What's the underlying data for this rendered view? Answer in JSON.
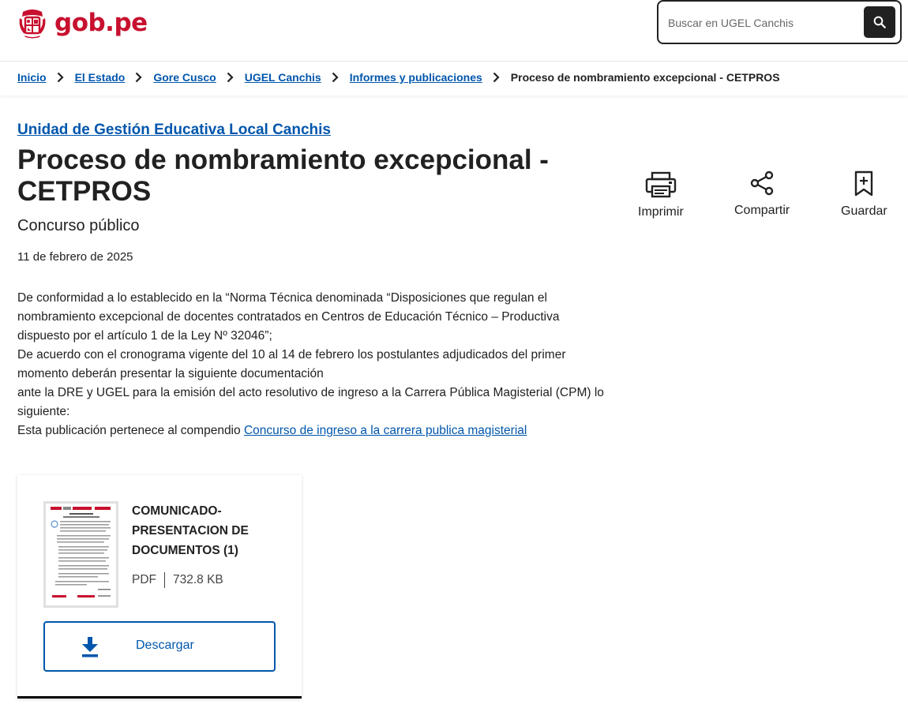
{
  "header": {
    "logo_text": "gob.pe",
    "search_placeholder": "Buscar en UGEL Canchis"
  },
  "breadcrumb": {
    "items": [
      "Inicio",
      "El Estado",
      "Gore Cusco",
      "UGEL Canchis",
      "Informes y publicaciones"
    ],
    "current": "Proceso de nombramiento excepcional - CETPROS"
  },
  "main": {
    "org_link": "Unidad de Gestión Educativa Local Canchis",
    "title": "Proceso de nombramiento excepcional - CETPROS",
    "subtitle": "Concurso público",
    "date": "11 de febrero de 2025",
    "paragraphs": [
      "De conformidad a lo establecido en la “Norma Técnica denominada “Disposiciones que regulan el nombramiento excepcional de docentes contratados en Centros de Educación Técnico – Productiva dispuesto por el artículo 1 de la Ley Nº 32046”;",
      "De acuerdo con el cronograma vigente del 10 al 14 de febrero los postulantes adjudicados del primer momento deberán presentar la siguiente documentación",
      "ante la DRE y UGEL para la emisión del acto resolutivo de ingreso a la Carrera Pública Magisterial (CPM) lo siguiente:"
    ],
    "compendium_prefix": "Esta publicación pertenece al compendio ",
    "compendium_link": "Concurso de ingreso a la carrera publica magisterial"
  },
  "actions": {
    "print_label": "Imprimir",
    "share_label": "Compartir",
    "save_label": "Guardar"
  },
  "document": {
    "title": "COMUNICADO-PRESENTACION DE DOCUMENTOS (1)",
    "format": "PDF",
    "size": "732.8 KB",
    "download_label": "Descargar"
  },
  "colors": {
    "brand_red": "#c8102e",
    "link_blue": "#0056ac",
    "text_dark": "#212121"
  }
}
